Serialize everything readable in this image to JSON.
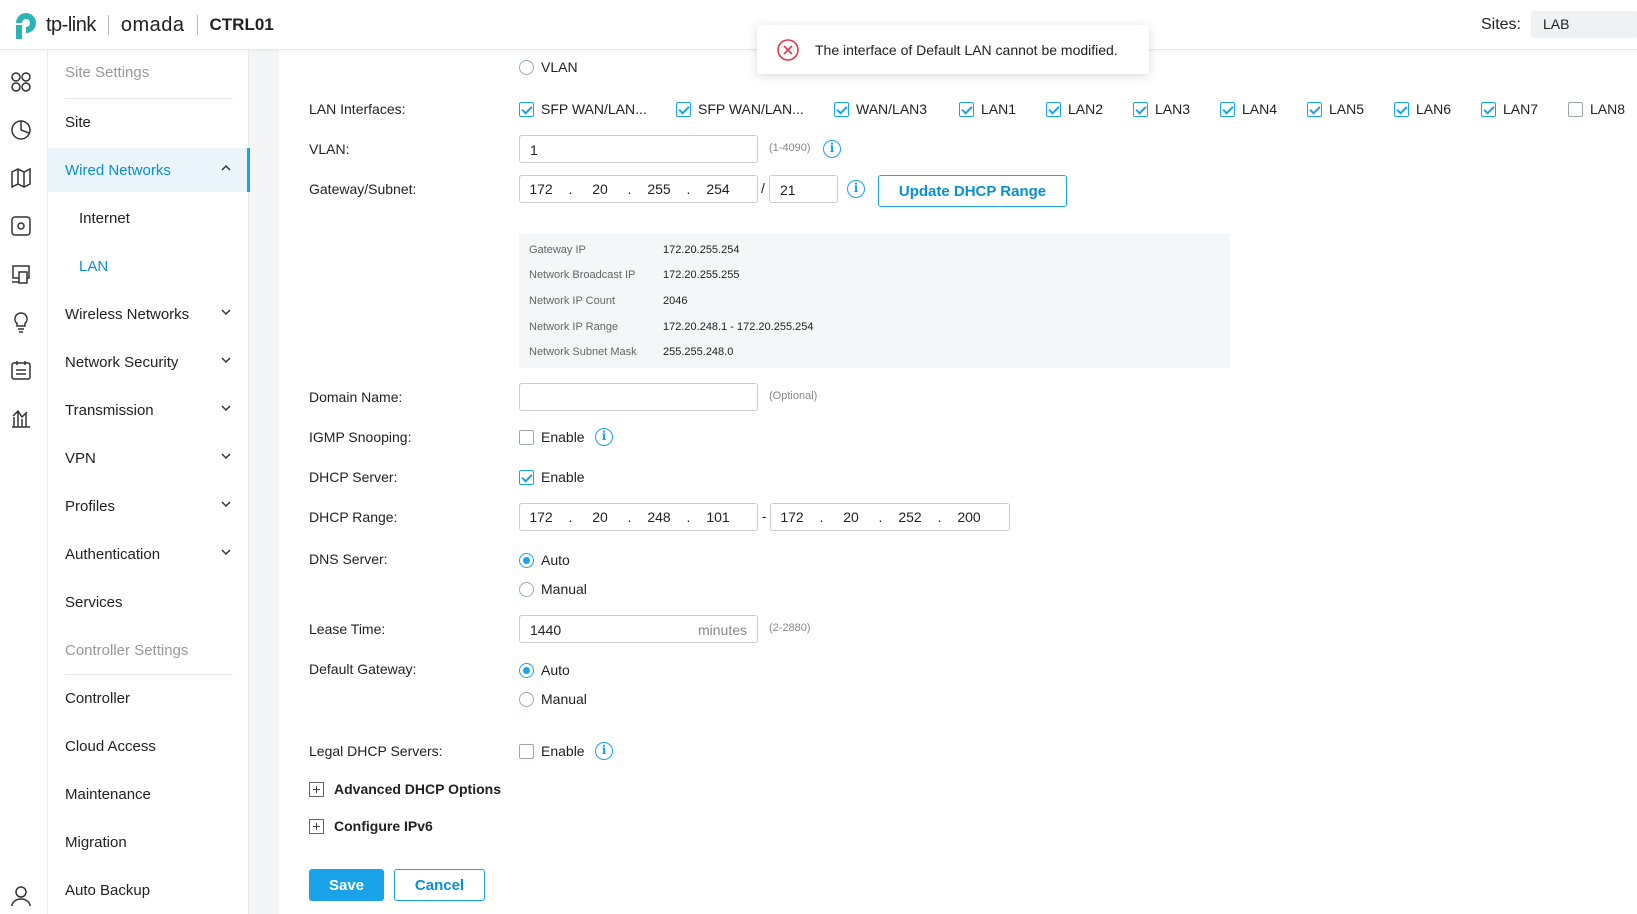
{
  "header": {
    "brand": "tp-link",
    "product": "omada",
    "controller_name": "CTRL01",
    "sites_label": "Sites:",
    "site_value": "LAB"
  },
  "toast": {
    "message": "The interface of Default LAN cannot be modified."
  },
  "icon_rail": [
    "dashboard-icon",
    "statistics-icon",
    "map-icon",
    "devices-icon",
    "clients-icon",
    "insight-icon",
    "log-icon",
    "reports-icon",
    "account-icon"
  ],
  "sidebar": {
    "items": [
      {
        "label": "Site Settings",
        "kind": "group"
      },
      {
        "label": "Site",
        "kind": "item"
      },
      {
        "label": "Wired Networks",
        "kind": "item",
        "expanded": true
      },
      {
        "label": "Internet",
        "kind": "sub"
      },
      {
        "label": "LAN",
        "kind": "sub",
        "selected": true
      },
      {
        "label": "Wireless Networks",
        "kind": "item",
        "collapsible": true
      },
      {
        "label": "Network Security",
        "kind": "item",
        "collapsible": true
      },
      {
        "label": "Transmission",
        "kind": "item",
        "collapsible": true
      },
      {
        "label": "VPN",
        "kind": "item",
        "collapsible": true
      },
      {
        "label": "Profiles",
        "kind": "item",
        "collapsible": true
      },
      {
        "label": "Authentication",
        "kind": "item",
        "collapsible": true
      },
      {
        "label": "Services",
        "kind": "item"
      },
      {
        "label": "Controller Settings",
        "kind": "group"
      },
      {
        "label": "Controller",
        "kind": "item"
      },
      {
        "label": "Cloud Access",
        "kind": "item"
      },
      {
        "label": "Maintenance",
        "kind": "item"
      },
      {
        "label": "Migration",
        "kind": "item"
      },
      {
        "label": "Auto Backup",
        "kind": "item"
      }
    ]
  },
  "form": {
    "purpose_vlan_label": "VLAN",
    "lan_interfaces": {
      "label": "LAN Interfaces:",
      "ports": [
        {
          "name": "SFP WAN/LAN...",
          "checked": true
        },
        {
          "name": "SFP WAN/LAN...",
          "checked": true
        },
        {
          "name": "WAN/LAN3",
          "checked": true
        },
        {
          "name": "LAN1",
          "checked": true
        },
        {
          "name": "LAN2",
          "checked": true
        },
        {
          "name": "LAN3",
          "checked": true
        },
        {
          "name": "LAN4",
          "checked": true
        },
        {
          "name": "LAN5",
          "checked": true
        },
        {
          "name": "LAN6",
          "checked": true
        },
        {
          "name": "LAN7",
          "checked": true
        },
        {
          "name": "LAN8",
          "checked": false
        }
      ]
    },
    "vlan": {
      "label": "VLAN:",
      "value": "1",
      "hint": "(1-4090)"
    },
    "gateway_subnet": {
      "label": "Gateway/Subnet:",
      "octets": [
        "172",
        "20",
        "255",
        "254"
      ],
      "separator": "/",
      "mask": "21",
      "update_button": "Update DHCP Range"
    },
    "network_info": [
      {
        "key": "Gateway IP",
        "value": "172.20.255.254"
      },
      {
        "key": "Network Broadcast IP",
        "value": "172.20.255.255"
      },
      {
        "key": "Network IP Count",
        "value": "2046"
      },
      {
        "key": "Network IP Range",
        "value": "172.20.248.1 - 172.20.255.254"
      },
      {
        "key": "Network Subnet Mask",
        "value": "255.255.248.0"
      }
    ],
    "domain_name": {
      "label": "Domain Name:",
      "value": "",
      "hint": "(Optional)"
    },
    "igmp_snooping": {
      "label": "IGMP Snooping:",
      "option": "Enable",
      "checked": false
    },
    "dhcp_server": {
      "label": "DHCP Server:",
      "option": "Enable",
      "checked": true
    },
    "dhcp_range": {
      "label": "DHCP Range:",
      "start": [
        "172",
        "20",
        "248",
        "101"
      ],
      "dash": "-",
      "end": [
        "172",
        "20",
        "252",
        "200"
      ]
    },
    "dns_server": {
      "label": "DNS Server:",
      "options": [
        "Auto",
        "Manual"
      ],
      "selected": "Auto"
    },
    "lease_time": {
      "label": "Lease Time:",
      "value": "1440",
      "unit": "minutes",
      "hint": "(2-2880)"
    },
    "default_gateway": {
      "label": "Default Gateway:",
      "options": [
        "Auto",
        "Manual"
      ],
      "selected": "Auto"
    },
    "legal_dhcp_servers": {
      "label": "Legal DHCP Servers:",
      "option": "Enable",
      "checked": false
    },
    "advanced_dhcp": "Advanced DHCP Options",
    "configure_ipv6": "Configure IPv6",
    "save": "Save",
    "cancel": "Cancel"
  },
  "colors": {
    "accent": "#1aa3e8",
    "error": "#e0384b"
  },
  "dot": "."
}
